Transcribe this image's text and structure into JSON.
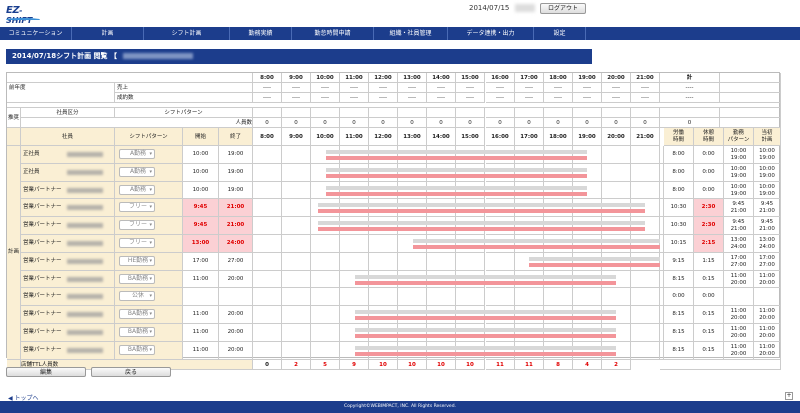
{
  "header": {
    "logo_ez": "EZ",
    "logo_shift": "SHIFT",
    "date": "2014/07/15",
    "logout": "ログアウト"
  },
  "nav": [
    "コミュニケーション",
    "計画",
    "シフト計画",
    "勤務実績",
    "勤怠時間申請",
    "組織・社員管理",
    "データ連携・出力",
    "設定"
  ],
  "title": {
    "text": "2014/07/18シフト計画 閲覧 【"
  },
  "table": {
    "hours": [
      "8:00",
      "9:00",
      "10:00",
      "11:00",
      "12:00",
      "13:00",
      "14:00",
      "15:00",
      "16:00",
      "17:00",
      "18:00",
      "19:00",
      "20:00",
      "21:00"
    ],
    "total_label": "計",
    "prev_year_label": "前年度",
    "sales_label": "売上",
    "deal_label": "成約数",
    "dash": "----",
    "plan_label": "推奨",
    "dept_label": "社員区分",
    "shift_pattern_label": "シフトパターン",
    "headcount_label": "人員数",
    "zero": "0",
    "employee_label": "社員",
    "start_label": "開始",
    "end_label": "終了",
    "work_time_label": "労働時間",
    "break_time_label": "休憩時間",
    "duty_pattern_label": "勤務パターン",
    "today_plan_label": "当初計画",
    "plan_side_label": "計画",
    "ttl_label": "店舗TTL人員数",
    "ttl_values": [
      "0",
      "2",
      "5",
      "9",
      "10",
      "10",
      "10",
      "10",
      "11",
      "11",
      "8",
      "4",
      "2"
    ]
  },
  "rows": [
    {
      "cls": "正社員",
      "pattern": "A勤務",
      "start": "10:00",
      "end": "19:00",
      "work": "8:00",
      "brk": "0:00",
      "duty": [
        "10:00",
        "19:00"
      ],
      "plan": [
        "10:00",
        "19:00"
      ]
    },
    {
      "cls": "正社員",
      "pattern": "A勤務",
      "start": "10:00",
      "end": "19:00",
      "work": "8:00",
      "brk": "0:00",
      "duty": [
        "10:00",
        "19:00"
      ],
      "plan": [
        "10:00",
        "19:00"
      ]
    },
    {
      "cls": "営業パートナー",
      "pattern": "A勤務",
      "start": "10:00",
      "end": "19:00",
      "work": "8:00",
      "brk": "0:00",
      "duty": [
        "10:00",
        "19:00"
      ],
      "plan": [
        "10:00",
        "19:00"
      ]
    },
    {
      "cls": "営業パートナー",
      "pattern": "フリー",
      "start": "9:45",
      "end": "21:00",
      "work": "10:30",
      "brk": "2:30",
      "duty": [
        "9:45",
        "21:00"
      ],
      "plan": [
        "9:45",
        "21:00"
      ]
    },
    {
      "cls": "営業パートナー",
      "pattern": "フリー",
      "start": "9:45",
      "end": "21:00",
      "work": "10:30",
      "brk": "2:30",
      "duty": [
        "9:45",
        "21:00"
      ],
      "plan": [
        "9:45",
        "21:00"
      ]
    },
    {
      "cls": "営業パートナー",
      "pattern": "フリー",
      "start": "13:00",
      "end": "24:00",
      "work": "10:15",
      "brk": "2:15",
      "duty": [
        "13:00",
        "24:00"
      ],
      "plan": [
        "13:00",
        "24:00"
      ]
    },
    {
      "cls": "営業パートナー",
      "pattern": "HE勤務",
      "start": "17:00",
      "end": "27:00",
      "work": "9:15",
      "brk": "1:15",
      "duty": [
        "17:00",
        "27:00"
      ],
      "plan": [
        "17:00",
        "27:00"
      ]
    },
    {
      "cls": "営業パートナー",
      "pattern": "BA勤務",
      "start": "11:00",
      "end": "20:00",
      "work": "8:15",
      "brk": "0:15",
      "duty": [
        "11:00",
        "20:00"
      ],
      "plan": [
        "11:00",
        "20:00"
      ]
    },
    {
      "cls": "営業パートナー",
      "pattern": "公休",
      "start": "",
      "end": "",
      "work": "0:00",
      "brk": "0:00",
      "duty": [
        "",
        ""
      ],
      "plan": [
        "",
        ""
      ]
    },
    {
      "cls": "営業パートナー",
      "pattern": "BA勤務",
      "start": "11:00",
      "end": "20:00",
      "work": "8:15",
      "brk": "0:15",
      "duty": [
        "11:00",
        "20:00"
      ],
      "plan": [
        "11:00",
        "20:00"
      ]
    },
    {
      "cls": "営業パートナー",
      "pattern": "BA勤務",
      "start": "11:00",
      "end": "20:00",
      "work": "8:15",
      "brk": "0:15",
      "duty": [
        "11:00",
        "20:00"
      ],
      "plan": [
        "11:00",
        "20:00"
      ]
    },
    {
      "cls": "営業パートナー",
      "pattern": "BA勤務",
      "start": "11:00",
      "end": "20:00",
      "work": "8:15",
      "brk": "0:15",
      "duty": [
        "11:00",
        "20:00"
      ],
      "plan": [
        "11:00",
        "20:00"
      ]
    }
  ],
  "buttons": {
    "edit": "編集",
    "back": "戻る"
  },
  "footer": {
    "top_link": "トップへ",
    "copyright": "Copyright©WEBIMPACT, INC. All Rights Reserved.",
    "fx": "+"
  }
}
